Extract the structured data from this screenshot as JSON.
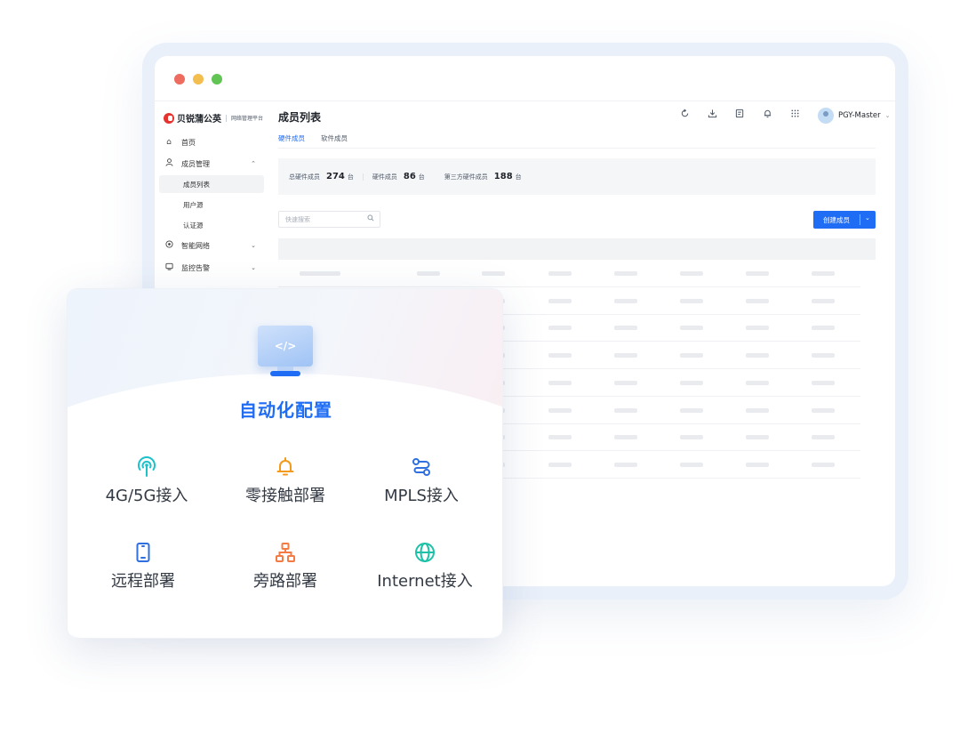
{
  "app": {
    "brand": "贝锐蒲公英",
    "brand_sub": "网络管理平台"
  },
  "sidebar": {
    "items": [
      {
        "label": "首页",
        "icon": "home-icon"
      },
      {
        "label": "成员管理",
        "icon": "user-icon",
        "expanded": true,
        "children": [
          {
            "label": "成员列表",
            "active": true
          },
          {
            "label": "用户源"
          },
          {
            "label": "认证源"
          }
        ]
      },
      {
        "label": "智能网络",
        "icon": "network-icon"
      },
      {
        "label": "监控告警",
        "icon": "monitor-icon"
      }
    ]
  },
  "header": {
    "title": "成员列表",
    "tabs": [
      {
        "label": "硬件成员",
        "active": true
      },
      {
        "label": "软件成员"
      }
    ],
    "toolbar_icons": [
      "refresh-icon",
      "download-icon",
      "edit-icon",
      "bell-icon",
      "apps-grid-icon"
    ],
    "user": "PGY-Master"
  },
  "stats": {
    "total_label": "总硬件成员",
    "total_value": "274",
    "total_unit": "台",
    "hw_label": "硬件成员",
    "hw_value": "86",
    "hw_unit": "台",
    "third_label": "第三方硬件成员",
    "third_value": "188",
    "third_unit": "台"
  },
  "search": {
    "placeholder": "快速搜索"
  },
  "create_button": "创建成员",
  "table": {
    "skeleton_rows": 8
  },
  "feature_card": {
    "title": "自动化配置",
    "features": [
      {
        "label": "4G/5G接入",
        "icon": "antenna-icon",
        "color": "#1cc1c9"
      },
      {
        "label": "零接触部署",
        "icon": "bell-icon",
        "color": "#f39a1b"
      },
      {
        "label": "MPLS接入",
        "icon": "route-icon",
        "color": "#2f6fe0"
      },
      {
        "label": "远程部署",
        "icon": "phone-icon",
        "color": "#2f6fe0"
      },
      {
        "label": "旁路部署",
        "icon": "topology-icon",
        "color": "#f47b43"
      },
      {
        "label": "Internet接入",
        "icon": "globe-icon",
        "color": "#1cc1a8"
      }
    ]
  },
  "colors": {
    "accent": "#1f6cf5",
    "frame": "#e9f0fa"
  }
}
